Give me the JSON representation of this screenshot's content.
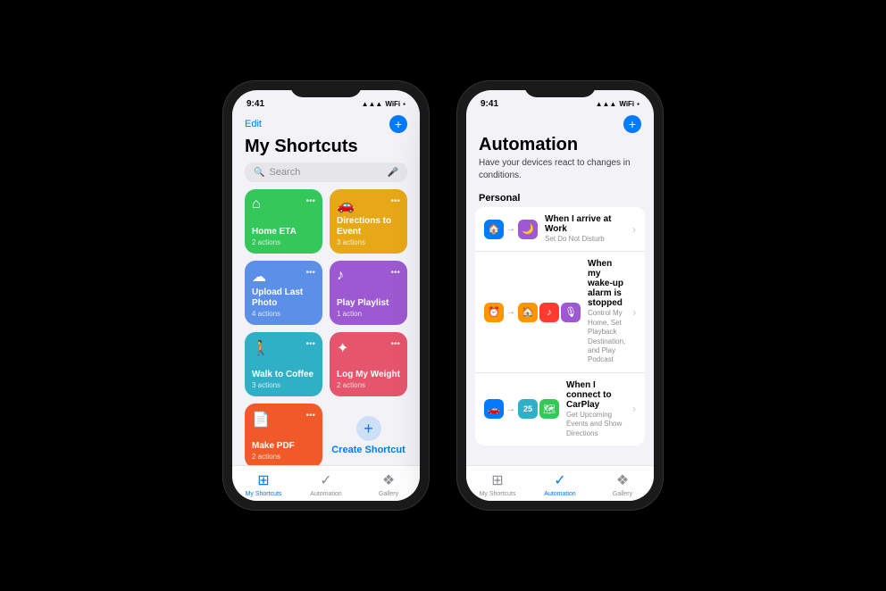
{
  "phone1": {
    "status": {
      "time": "9:41",
      "icons": "▲ ▲ ▲"
    },
    "header": {
      "edit_label": "Edit",
      "title": "My Shortcuts"
    },
    "search": {
      "placeholder": "Search"
    },
    "shortcuts": [
      {
        "name": "Home ETA",
        "actions": "2 actions",
        "color": "green",
        "icon": "⌂"
      },
      {
        "name": "Directions to Event",
        "actions": "3 actions",
        "color": "yellow",
        "icon": "🚗"
      },
      {
        "name": "Upload Last Photo",
        "actions": "4 actions",
        "color": "blue-card",
        "icon": "☁"
      },
      {
        "name": "Play Playlist",
        "actions": "1 action",
        "color": "purple",
        "icon": "♪"
      },
      {
        "name": "Walk to Coffee",
        "actions": "3 actions",
        "color": "teal",
        "icon": "☕"
      },
      {
        "name": "Log My Weight",
        "actions": "2 actions",
        "color": "pink",
        "icon": "✦"
      },
      {
        "name": "Make PDF",
        "actions": "2 actions",
        "color": "orange",
        "icon": "📄"
      }
    ],
    "create_shortcut": "Create Shortcut",
    "tabs": [
      {
        "label": "My Shortcuts",
        "active": true
      },
      {
        "label": "Automation",
        "active": false
      },
      {
        "label": "Gallery",
        "active": false
      }
    ]
  },
  "phone2": {
    "status": {
      "time": "9:41",
      "icons": "▲ ▲ ▲"
    },
    "header": {
      "title": "Automation",
      "subtitle": "Have your devices react to changes in conditions."
    },
    "section": "Personal",
    "automations": [
      {
        "title": "When I arrive at Work",
        "description": "Set Do Not Disturb",
        "icons": [
          "house-icon",
          "moon-icon"
        ],
        "icon_colors": [
          "icon-blue",
          "icon-purple"
        ]
      },
      {
        "title": "When my wake-up alarm is stopped",
        "description": "Control My Home, Set Playback Destination, and Play Podcast",
        "icons": [
          "alarm-icon",
          "home-icon",
          "music-icon",
          "podcast-icon"
        ],
        "icon_colors": [
          "icon-orange",
          "icon-orange",
          "icon-red",
          "icon-purple"
        ]
      },
      {
        "title": "When I connect to CarPlay",
        "description": "Get Upcoming Events and Show Directions",
        "icons": [
          "car-icon",
          "num-icon",
          "map-icon"
        ],
        "icon_colors": [
          "icon-blue",
          "icon-teal",
          "icon-green"
        ]
      }
    ],
    "tabs": [
      {
        "label": "My Shortcuts",
        "active": false
      },
      {
        "label": "Automation",
        "active": true
      },
      {
        "label": "Gallery",
        "active": false
      }
    ]
  }
}
